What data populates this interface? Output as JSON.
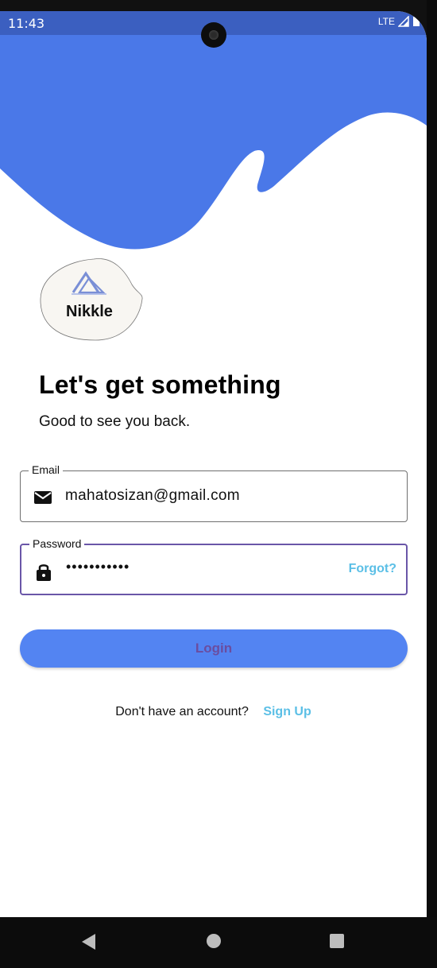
{
  "status_bar": {
    "time": "11:43",
    "network": "LTE"
  },
  "logo": {
    "name": "Nikkle"
  },
  "heading": "Let's get something",
  "subheading": "Good to see you back.",
  "email_field": {
    "label": "Email",
    "value": "mahatosizan@gmail.com",
    "icon": "mail-icon"
  },
  "password_field": {
    "label": "Password",
    "value": "•••••••••••",
    "icon": "lock-icon",
    "forgot_label": "Forgot?"
  },
  "login_button": {
    "label": "Login"
  },
  "signup": {
    "prompt": "Don't have an account?",
    "link": "Sign Up"
  },
  "colors": {
    "wave_blue": "#4a78e8",
    "status_bar": "#3b5fc0",
    "button_blue": "#5384f2",
    "link_blue": "#5bbfe6",
    "focus_purple": "#6a56a8"
  }
}
